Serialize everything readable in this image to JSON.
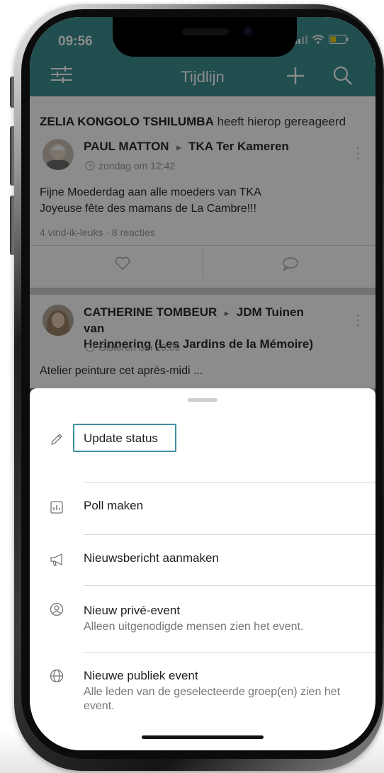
{
  "status_bar": {
    "time": "09:56"
  },
  "header": {
    "title": "Tijdlijn"
  },
  "feed": {
    "reaction_name": "ZELIA KONGOLO TSHILUMBA",
    "reaction_suffix": " heeft hierop gereageerd",
    "post1": {
      "author": "PAUL MATTON",
      "group": "TKA Ter Kameren",
      "time": "zondag om 12:42",
      "text_line1": "Fijne Moederdag aan alle moeders van TKA",
      "text_line2": "Joyeuse fête des mamans de La Cambre!!!",
      "stats": "4 vind-ik-leuks · 8 reacties"
    },
    "post2": {
      "author": "CATHERINE TOMBEUR",
      "group_line1": "JDM Tuinen van",
      "group_line2": "Herinnering (Les Jardins de la Mémoire)",
      "time": "Gisteren om 20:09",
      "text": "Atelier peinture cet après-midi ..."
    }
  },
  "sheet": {
    "items": [
      {
        "icon": "pencil-icon",
        "title": "Update status",
        "subtitle": ""
      },
      {
        "icon": "poll-chart-icon",
        "title": "Poll maken",
        "subtitle": ""
      },
      {
        "icon": "megaphone-icon",
        "title": "Nieuwsbericht aanmaken",
        "subtitle": ""
      },
      {
        "icon": "user-circle-icon",
        "title": "Nieuw privé-event",
        "subtitle": "Alleen uitgenodigde mensen zien het event."
      },
      {
        "icon": "globe-icon",
        "title": "Nieuwe publiek event",
        "subtitle": "Alle leden van de geselecteerde groep(en) zien het event."
      }
    ]
  },
  "colors": {
    "header": "#3d8e91",
    "focus_outline": "#3f8fa0",
    "battery": "#f2d21b"
  }
}
